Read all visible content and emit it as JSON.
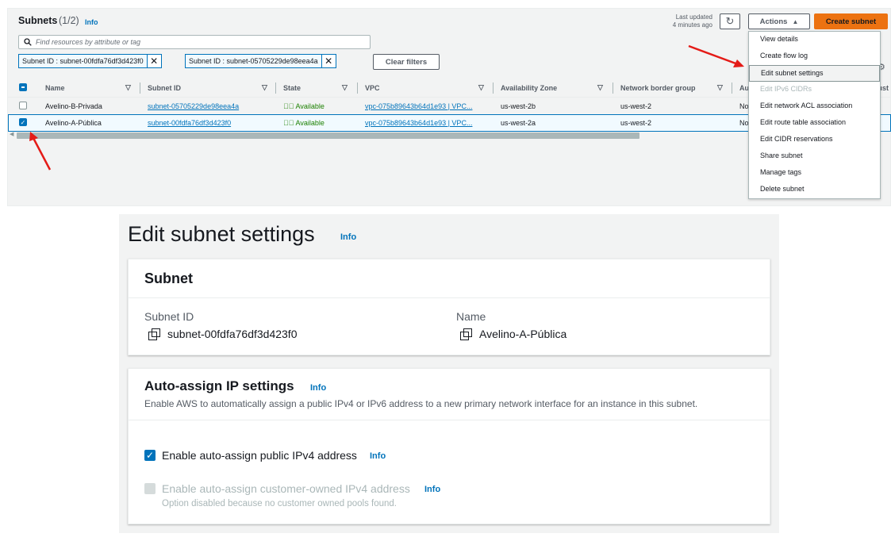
{
  "list": {
    "title": "Subnets",
    "count": "(1/2)",
    "info": "Info",
    "last_updated": "Last updated",
    "last_updated_time": "4 minutes ago",
    "refresh_icon": "refresh-icon",
    "actions_label": "Actions",
    "create_label": "Create subnet",
    "search_placeholder": "Find resources by attribute or tag",
    "filters": [
      "Subnet ID : subnet-00fdfa76df3d423f0",
      "Subnet ID : subnet-05705229de98eea4a"
    ],
    "clear_filters": "Clear filters",
    "columns": [
      "Name",
      "Subnet ID",
      "State",
      "VPC",
      "Availability Zone",
      "Network border group",
      "Au",
      "Cust"
    ],
    "rows": [
      {
        "name": "Avelino-B-Privada",
        "subnet_id": "subnet-05705229de98eea4a",
        "state": "Available",
        "vpc": "vpc-075b89643b64d1e93 | VPC...",
        "az": "us-west-2b",
        "nbg": "us-west-2",
        "auto": "No",
        "selected": false
      },
      {
        "name": "Avelino-A-Pública",
        "subnet_id": "subnet-00fdfa76df3d423f0",
        "state": "Available",
        "vpc": "vpc-075b89643b64d1e93 | VPC...",
        "az": "us-west-2a",
        "nbg": "us-west-2",
        "auto": "No",
        "selected": true
      }
    ]
  },
  "actions_menu": [
    {
      "label": "View details",
      "disabled": false
    },
    {
      "label": "Create flow log",
      "disabled": false
    },
    {
      "label": "Edit subnet settings",
      "disabled": false,
      "highlighted": true
    },
    {
      "label": "Edit IPv6 CIDRs",
      "disabled": true
    },
    {
      "label": "Edit network ACL association",
      "disabled": false
    },
    {
      "label": "Edit route table association",
      "disabled": false
    },
    {
      "label": "Edit CIDR reservations",
      "disabled": false
    },
    {
      "label": "Share subnet",
      "disabled": false
    },
    {
      "label": "Manage tags",
      "disabled": false
    },
    {
      "label": "Delete subnet",
      "disabled": false
    }
  ],
  "edit": {
    "title": "Edit subnet settings",
    "info": "Info",
    "subnet_card": {
      "title": "Subnet",
      "id_label": "Subnet ID",
      "id_value": "subnet-00fdfa76df3d423f0",
      "name_label": "Name",
      "name_value": "Avelino-A-Pública"
    },
    "auto_assign": {
      "title": "Auto-assign IP settings",
      "info": "Info",
      "description": "Enable AWS to automatically assign a public IPv4 or IPv6 address to a new primary network interface for an instance in this subnet.",
      "public_ipv4_label": "Enable auto-assign public IPv4 address",
      "public_ipv4_checked": true,
      "customer_ipv4_label": "Enable auto-assign customer-owned IPv4 address",
      "customer_ipv4_checked": false,
      "customer_ipv4_note": "Option disabled because no customer owned pools found."
    }
  },
  "colors": {
    "accent": "#0073bb",
    "primary_button": "#ec7211",
    "success": "#1d8102",
    "annotation_arrow": "#e41b17"
  }
}
